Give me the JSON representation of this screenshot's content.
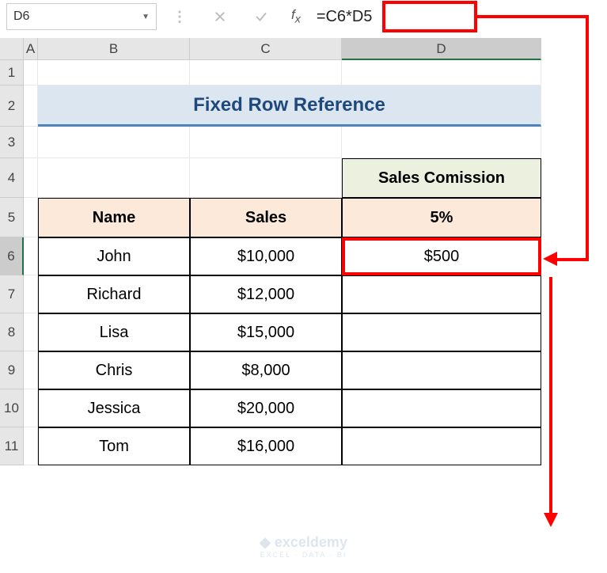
{
  "formula_bar": {
    "cell_ref": "D6",
    "formula": "=C6*D5"
  },
  "columns": {
    "A": "A",
    "B": "B",
    "C": "C",
    "D": "D"
  },
  "rows": [
    "1",
    "2",
    "3",
    "4",
    "5",
    "6",
    "7",
    "8",
    "9",
    "10",
    "11"
  ],
  "title": "Fixed Row Reference",
  "headers": {
    "commission_label": "Sales Comission",
    "name": "Name",
    "sales": "Sales",
    "rate": "5%"
  },
  "table": [
    {
      "name": "John",
      "sales": "$10,000",
      "commission": "$500"
    },
    {
      "name": "Richard",
      "sales": "$12,000",
      "commission": ""
    },
    {
      "name": "Lisa",
      "sales": "$15,000",
      "commission": ""
    },
    {
      "name": "Chris",
      "sales": "$8,000",
      "commission": ""
    },
    {
      "name": "Jessica",
      "sales": "$20,000",
      "commission": ""
    },
    {
      "name": "Tom",
      "sales": "$16,000",
      "commission": ""
    }
  ],
  "watermark": {
    "brand": "exceldemy",
    "tagline": "EXCEL · DATA · BI"
  }
}
